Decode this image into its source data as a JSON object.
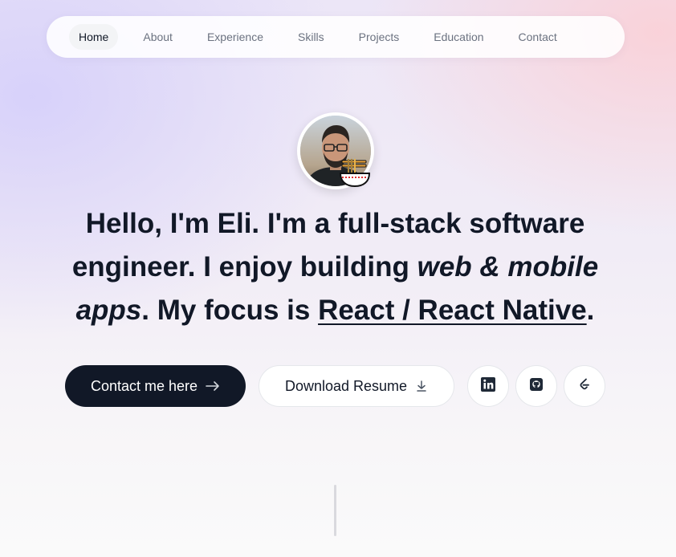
{
  "nav": {
    "items": [
      {
        "label": "Home",
        "active": true
      },
      {
        "label": "About"
      },
      {
        "label": "Experience"
      },
      {
        "label": "Skills"
      },
      {
        "label": "Projects"
      },
      {
        "label": "Education"
      },
      {
        "label": "Contact"
      }
    ]
  },
  "hero": {
    "avatar_icon": "profile-photo",
    "badge_icon": "ramen-bowl-icon",
    "headline": {
      "greeting": "Hello, I'm Eli.",
      "im_a": " I'm a ",
      "role": "full-stack software engineer.",
      "enjoy": " I enjoy building ",
      "what": "web & mobile apps",
      "focus_prefix": ". My focus is ",
      "focus": "React / React Native",
      "end": "."
    }
  },
  "actions": {
    "contact_label": "Contact me here",
    "contact_icon": "arrow-right-icon",
    "resume_label": "Download Resume",
    "resume_icon": "download-icon",
    "social": [
      "linkedin-icon",
      "github-icon",
      "leetcode-icon"
    ]
  },
  "colors": {
    "primary": "#111827",
    "muted": "#6b7280",
    "gradient_left": "#d6d0fa",
    "gradient_right": "#fbd0d6"
  }
}
